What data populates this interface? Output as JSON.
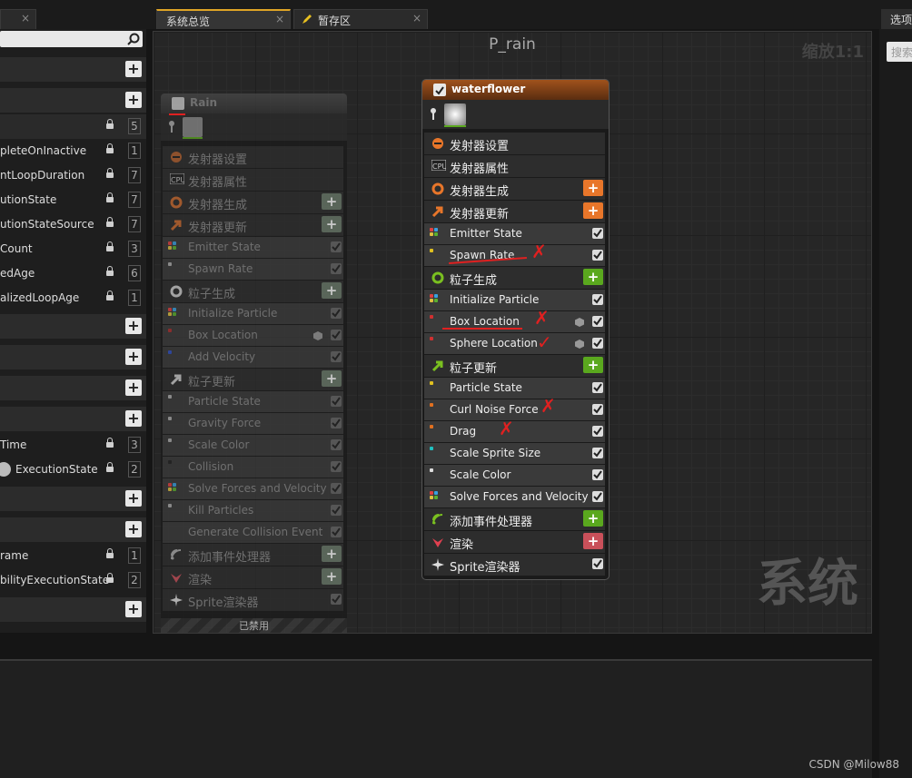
{
  "tabs": [
    {
      "label": "",
      "close": "×"
    },
    {
      "label": "系统总览",
      "close": "×"
    },
    {
      "label": "暂存区",
      "close": "×"
    }
  ],
  "right_panel": {
    "tab": "选项",
    "search_placeholder": "搜索"
  },
  "left_panel": {
    "rows": [
      {
        "text": "pleteOnInactive",
        "num": "1"
      },
      {
        "text": "ntLoopDuration",
        "num": "7"
      },
      {
        "text": "utionState",
        "num": "7"
      },
      {
        "text": "utionStateSource",
        "num": "7"
      },
      {
        "text": "Count",
        "num": "3"
      },
      {
        "text": "edAge",
        "num": "6"
      },
      {
        "text": "alizedLoopAge",
        "num": "1"
      },
      {
        "text": "Time",
        "num": "3"
      },
      {
        "text": "ExecutionState",
        "num": "2"
      },
      {
        "text": "rame",
        "num": "1"
      },
      {
        "text": "bilityExecutionState",
        "num": "2"
      }
    ],
    "top_num": "5"
  },
  "graph": {
    "title": "P_rain",
    "zoom": "缩放1:1",
    "watermark": "系统"
  },
  "node_rain": {
    "title": "Rain",
    "disabled_label": "已禁用",
    "rows": [
      "发射器设置",
      "发射器属性",
      "发射器生成",
      "发射器更新",
      "Emitter State",
      "Spawn Rate",
      "粒子生成",
      "Initialize Particle",
      "Box Location",
      "Add Velocity",
      "粒子更新",
      "Particle State",
      "Gravity Force",
      "Scale Color",
      "Collision",
      "Solve Forces and Velocity",
      "Kill Particles",
      "Generate Collision Event",
      "添加事件处理器",
      "渲染",
      "Sprite渲染器"
    ]
  },
  "node_water": {
    "title": "waterflower",
    "rows": [
      "发射器设置",
      "发射器属性",
      "发射器生成",
      "发射器更新",
      "Emitter State",
      "Spawn Rate",
      "粒子生成",
      "Initialize Particle",
      "Box Location",
      "Sphere Location",
      "粒子更新",
      "Particle State",
      "Curl Noise Force",
      "Drag",
      "Scale Sprite Size",
      "Scale Color",
      "Solve Forces and Velocity",
      "添加事件处理器",
      "渲染",
      "Sprite渲染器"
    ]
  },
  "footer": "CSDN @Milow88",
  "colors": {
    "accent": "#e0a526",
    "orange_add": "#e8762a",
    "green_add": "#5aa81e",
    "red_add": "#c9505a",
    "annotation": "#e02020"
  }
}
